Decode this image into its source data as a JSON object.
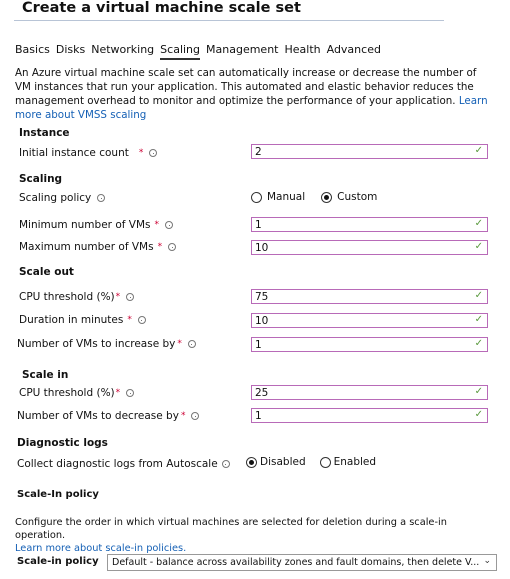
{
  "header": {
    "title": "Create a virtual machine scale set"
  },
  "tabs": [
    {
      "label": "Basics"
    },
    {
      "label": "Disks"
    },
    {
      "label": "Networking"
    },
    {
      "label": "Scaling",
      "active": true
    },
    {
      "label": "Management"
    },
    {
      "label": "Health"
    },
    {
      "label": "Advanced"
    }
  ],
  "description": {
    "text": "An Azure virtual machine scale set can automatically increase or decrease the number of VM instances that run your application. This automated and elastic behavior reduces the management overhead to monitor and optimize the performance of your application.",
    "link": "Learn more about VMSS scaling"
  },
  "instance": {
    "heading": "Instance",
    "initial_count_label": "Initial instance count",
    "initial_count_value": "2"
  },
  "scaling": {
    "heading": "Scaling",
    "policy_label": "Scaling policy",
    "policy_options": [
      "Manual",
      "Custom"
    ],
    "policy_selected": "Custom",
    "min_label": "Minimum number of VMs",
    "min_value": "1",
    "max_label": "Maximum number of VMs",
    "max_value": "10"
  },
  "scale_out": {
    "heading": "Scale out",
    "cpu_label": "CPU threshold (%)",
    "cpu_value": "75",
    "duration_label": "Duration in minutes",
    "duration_value": "10",
    "increase_label": "Number of VMs to increase by",
    "increase_value": "1"
  },
  "scale_in": {
    "heading": "Scale in",
    "cpu_label": "CPU threshold (%)",
    "cpu_value": "25",
    "decrease_label": "Number of VMs to decrease by",
    "decrease_value": "1"
  },
  "diagnostics": {
    "heading": "Diagnostic logs",
    "collect_label": "Collect diagnostic logs from Autoscale",
    "options": [
      "Disabled",
      "Enabled"
    ],
    "selected": "Disabled"
  },
  "scale_in_policy": {
    "heading": "Scale-In policy",
    "description": "Configure the order in which virtual machines are selected for deletion during a scale-in operation.",
    "link": "Learn more about scale-in policies.",
    "select_label": "Scale-in policy",
    "select_value": "Default - balance across availability zones and fault domains, then delete V..."
  },
  "colors": {
    "link": "#1560b5",
    "field_border": "#b86ab8",
    "check": "#5a9a3e",
    "required": "#cc0033"
  },
  "icons": {
    "info": "info-circle-icon",
    "valid": "checkmark-icon",
    "dropdown": "chevron-down-icon"
  }
}
